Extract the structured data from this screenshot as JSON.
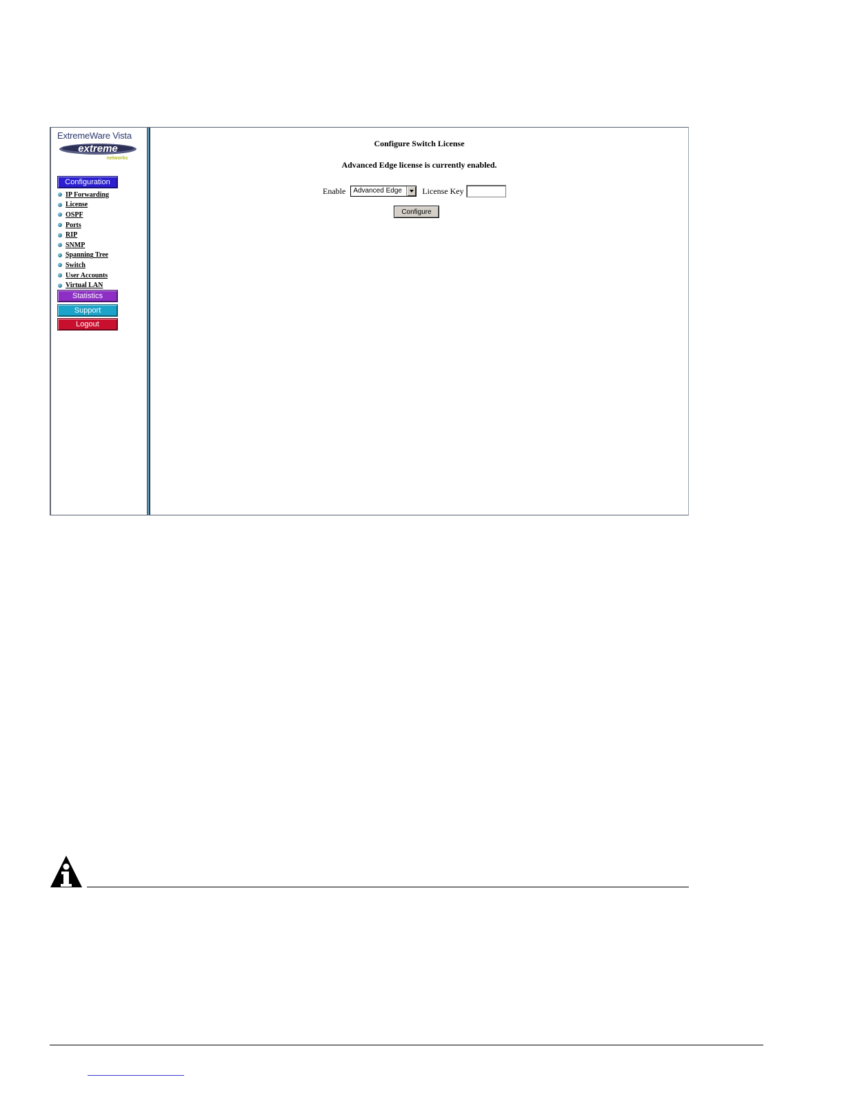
{
  "sidebar": {
    "brand_title": "ExtremeWare Vista",
    "logo_text": "extreme",
    "logo_subtext": "networks",
    "configuration_label": "Configuration",
    "nav_items": [
      {
        "label": "IP Forwarding"
      },
      {
        "label": "License"
      },
      {
        "label": "OSPF"
      },
      {
        "label": "Ports"
      },
      {
        "label": "RIP"
      },
      {
        "label": "SNMP"
      },
      {
        "label": "Spanning Tree"
      },
      {
        "label": "Switch"
      },
      {
        "label": "User Accounts"
      },
      {
        "label": "Virtual LAN"
      }
    ],
    "statistics_label": "Statistics",
    "support_label": "Support",
    "logout_label": "Logout"
  },
  "main": {
    "title": "Configure Switch License",
    "status_message": "Advanced Edge license is currently enabled.",
    "enable_label": "Enable",
    "enable_selected": "Advanced Edge",
    "license_key_label": "License Key",
    "license_key_value": "",
    "configure_button": "Configure"
  },
  "colors": {
    "configuration": "#2b1fd0",
    "statistics": "#8d2fc4",
    "support": "#1ba3c9",
    "logout": "#c8102e"
  }
}
